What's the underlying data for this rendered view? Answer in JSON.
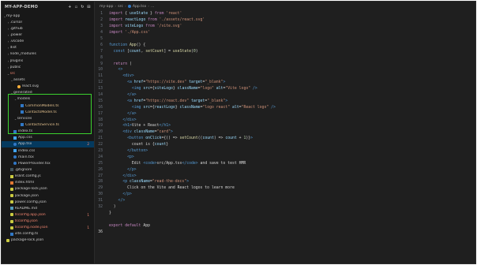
{
  "explorer": {
    "title": "MY-APP-DEMO",
    "items": [
      {
        "label": "my-app",
        "depth": 0,
        "kind": "folder",
        "open": true
      },
      {
        "label": ".cursor",
        "depth": 1,
        "kind": "folder",
        "open": false
      },
      {
        "label": ".github",
        "depth": 1,
        "kind": "folder",
        "open": false
      },
      {
        "label": ".power",
        "depth": 1,
        "kind": "folder",
        "open": false
      },
      {
        "label": ".vscode",
        "depth": 1,
        "kind": "folder",
        "open": false
      },
      {
        "label": "dist",
        "depth": 1,
        "kind": "folder",
        "open": false
      },
      {
        "label": "node_modules",
        "depth": 1,
        "kind": "folder",
        "open": false
      },
      {
        "label": "plugins",
        "depth": 1,
        "kind": "folder",
        "open": false
      },
      {
        "label": "public",
        "depth": 1,
        "kind": "folder",
        "open": false
      },
      {
        "label": "src",
        "depth": 1,
        "kind": "folder",
        "open": true,
        "error": true
      },
      {
        "label": "assets",
        "depth": 2,
        "kind": "folder",
        "open": true
      },
      {
        "label": "react.svg",
        "depth": 3,
        "kind": "svg"
      },
      {
        "label": "generated",
        "depth": 2,
        "kind": "folder",
        "open": true
      },
      {
        "label": "models",
        "depth": 3,
        "kind": "folder",
        "open": true
      },
      {
        "label": "CommonModels.ts",
        "depth": 4,
        "kind": "ts",
        "color": "#e2c08d"
      },
      {
        "label": "ContactsModel.ts",
        "depth": 4,
        "kind": "ts",
        "color": "#e2c08d"
      },
      {
        "label": "services",
        "depth": 3,
        "kind": "folder",
        "open": true
      },
      {
        "label": "ContactsService.ts",
        "depth": 4,
        "kind": "ts",
        "color": "#e2c08d"
      },
      {
        "label": "index.ts",
        "depth": 2,
        "kind": "ts"
      },
      {
        "label": "App.css",
        "depth": 2,
        "kind": "css"
      },
      {
        "label": "App.tsx",
        "depth": 2,
        "kind": "tsx",
        "selected": true,
        "badge": "2"
      },
      {
        "label": "index.css",
        "depth": 2,
        "kind": "css"
      },
      {
        "label": "main.tsx",
        "depth": 2,
        "kind": "tsx"
      },
      {
        "label": "PowerProvider.tsx",
        "depth": 2,
        "kind": "tsx"
      },
      {
        "label": ".gitignore",
        "depth": 1,
        "kind": "git"
      },
      {
        "label": "eslint.config.js",
        "depth": 1,
        "kind": "js"
      },
      {
        "label": "index.html",
        "depth": 1,
        "kind": "html"
      },
      {
        "label": "package-lock.json",
        "depth": 1,
        "kind": "json"
      },
      {
        "label": "package.json",
        "depth": 1,
        "kind": "json"
      },
      {
        "label": "power.config.json",
        "depth": 1,
        "kind": "json"
      },
      {
        "label": "README.md",
        "depth": 1,
        "kind": "md"
      },
      {
        "label": "tsconfig.app.json",
        "depth": 1,
        "kind": "json",
        "error": true,
        "badge": "1"
      },
      {
        "label": "tsconfig.json",
        "depth": 1,
        "kind": "json",
        "error": true
      },
      {
        "label": "tsconfig.node.json",
        "depth": 1,
        "kind": "json",
        "error": true,
        "badge": "1"
      },
      {
        "label": "vite.config.ts",
        "depth": 1,
        "kind": "ts"
      },
      {
        "label": "package-lock.json",
        "depth": 0,
        "kind": "json"
      }
    ]
  },
  "breadcrumb": [
    "my-app",
    "src",
    "App.tsx",
    "..."
  ],
  "code": {
    "current_line": 36,
    "lines": [
      [
        [
          "kw",
          "import"
        ],
        [
          "txt",
          " { "
        ],
        [
          "var",
          "useState"
        ],
        [
          "txt",
          " } "
        ],
        [
          "kw",
          "from"
        ],
        [
          "str",
          " 'react'"
        ]
      ],
      [
        [
          "kw",
          "import"
        ],
        [
          "var",
          " reactLogo"
        ],
        [
          "kw",
          " from"
        ],
        [
          "str",
          " './assets/react.svg'"
        ]
      ],
      [
        [
          "kw",
          "import"
        ],
        [
          "var",
          " viteLogo"
        ],
        [
          "kw",
          " from"
        ],
        [
          "str",
          " '/vite.svg'"
        ]
      ],
      [
        [
          "kw",
          "import"
        ],
        [
          "str",
          " './App.css'"
        ]
      ],
      [],
      [
        [
          "kw2",
          "function"
        ],
        [
          "fn",
          " App"
        ],
        [
          "txt",
          "() {"
        ]
      ],
      [
        [
          "kw2",
          "  const"
        ],
        [
          "txt",
          " ["
        ],
        [
          "var",
          "count"
        ],
        [
          "txt",
          ", "
        ],
        [
          "fn",
          "setCount"
        ],
        [
          "txt",
          "] = "
        ],
        [
          "fn",
          "useState"
        ],
        [
          "txt",
          "("
        ],
        [
          "num",
          "0"
        ],
        [
          "txt",
          ")"
        ]
      ],
      [],
      [
        [
          "kw",
          "  return"
        ],
        [
          "txt",
          " ("
        ]
      ],
      [
        [
          "tag",
          "    <>"
        ]
      ],
      [
        [
          "tag",
          "      <div>"
        ]
      ],
      [
        [
          "tag",
          "        <a"
        ],
        [
          "attr",
          " href"
        ],
        [
          "txt",
          "="
        ],
        [
          "str",
          "\"https://vite.dev\""
        ],
        [
          "attr",
          " target"
        ],
        [
          "txt",
          "="
        ],
        [
          "str",
          "\"_blank\""
        ],
        [
          "tag",
          ">"
        ]
      ],
      [
        [
          "tag",
          "          <img"
        ],
        [
          "attr",
          " src"
        ],
        [
          "txt",
          "={"
        ],
        [
          "var",
          "viteLogo"
        ],
        [
          "txt",
          "}"
        ],
        [
          "attr",
          " className"
        ],
        [
          "txt",
          "="
        ],
        [
          "str",
          "\"logo\""
        ],
        [
          "attr",
          " alt"
        ],
        [
          "txt",
          "="
        ],
        [
          "str",
          "\"Vite logo\""
        ],
        [
          "tag",
          " />"
        ]
      ],
      [
        [
          "tag",
          "        </a>"
        ]
      ],
      [
        [
          "tag",
          "        <a"
        ],
        [
          "attr",
          " href"
        ],
        [
          "txt",
          "="
        ],
        [
          "str",
          "\"https://react.dev\""
        ],
        [
          "attr",
          " target"
        ],
        [
          "txt",
          "="
        ],
        [
          "str",
          "\"_blank\""
        ],
        [
          "tag",
          ">"
        ]
      ],
      [
        [
          "tag",
          "          <img"
        ],
        [
          "attr",
          " src"
        ],
        [
          "txt",
          "={"
        ],
        [
          "var",
          "reactLogo"
        ],
        [
          "txt",
          "}"
        ],
        [
          "attr",
          " className"
        ],
        [
          "txt",
          "="
        ],
        [
          "str",
          "\"logo react\""
        ],
        [
          "attr",
          " alt"
        ],
        [
          "txt",
          "="
        ],
        [
          "str",
          "\"React logo\""
        ],
        [
          "tag",
          " />"
        ]
      ],
      [
        [
          "tag",
          "        </a>"
        ]
      ],
      [
        [
          "tag",
          "      </div>"
        ]
      ],
      [
        [
          "tag",
          "      <h1>"
        ],
        [
          "txt",
          "Vite + React"
        ],
        [
          "tag",
          "</h1>"
        ]
      ],
      [
        [
          "tag",
          "      <div"
        ],
        [
          "attr",
          " className"
        ],
        [
          "txt",
          "="
        ],
        [
          "str",
          "\"card\""
        ],
        [
          "tag",
          ">"
        ]
      ],
      [
        [
          "tag",
          "        <button"
        ],
        [
          "attr",
          " onClick"
        ],
        [
          "txt",
          "={() => "
        ],
        [
          "fn",
          "setCount"
        ],
        [
          "txt",
          "(("
        ],
        [
          "var",
          "count"
        ],
        [
          "txt",
          ") => "
        ],
        [
          "var",
          "count"
        ],
        [
          "txt",
          " + "
        ],
        [
          "num",
          "1"
        ],
        [
          "txt",
          ")}"
        ],
        [
          "tag",
          ">"
        ]
      ],
      [
        [
          "txt",
          "          count is {"
        ],
        [
          "var",
          "count"
        ],
        [
          "txt",
          "}"
        ]
      ],
      [
        [
          "tag",
          "        </button>"
        ]
      ],
      [
        [
          "tag",
          "        <p>"
        ]
      ],
      [
        [
          "txt",
          "          Edit "
        ],
        [
          "tag",
          "<code>"
        ],
        [
          "txt",
          "src/App.tsx"
        ],
        [
          "tag",
          "</code>"
        ],
        [
          "txt",
          " and save to test HMR"
        ]
      ],
      [
        [
          "tag",
          "        </p>"
        ]
      ],
      [
        [
          "tag",
          "      </div>"
        ]
      ],
      [
        [
          "tag",
          "      <p"
        ],
        [
          "attr",
          " className"
        ],
        [
          "txt",
          "="
        ],
        [
          "str",
          "\"read-the-docs\""
        ],
        [
          "tag",
          ">"
        ]
      ],
      [
        [
          "txt",
          "        Click on the Vite and React logos to learn more"
        ]
      ],
      [
        [
          "tag",
          "      </p>"
        ]
      ],
      [
        [
          "tag",
          "    </>"
        ]
      ],
      [
        [
          "txt",
          "  )"
        ]
      ],
      [
        [
          "txt",
          "}"
        ]
      ],
      [],
      [
        [
          "kw",
          "export"
        ],
        [
          "kw",
          " default"
        ],
        [
          "txt",
          " App"
        ]
      ],
      []
    ],
    "line_numbers_override": {
      "33": "",
      "34": "",
      "35": "",
      "36": "36"
    }
  }
}
